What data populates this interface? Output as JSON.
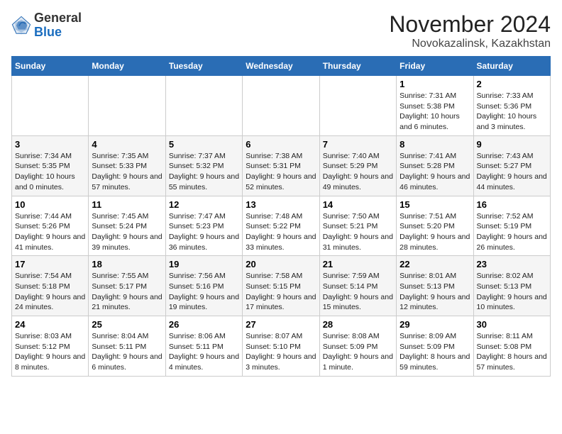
{
  "logo": {
    "general": "General",
    "blue": "Blue"
  },
  "header": {
    "month": "November 2024",
    "location": "Novokazalinsk, Kazakhstan"
  },
  "weekdays": [
    "Sunday",
    "Monday",
    "Tuesday",
    "Wednesday",
    "Thursday",
    "Friday",
    "Saturday"
  ],
  "weeks": [
    [
      {
        "day": "",
        "info": ""
      },
      {
        "day": "",
        "info": ""
      },
      {
        "day": "",
        "info": ""
      },
      {
        "day": "",
        "info": ""
      },
      {
        "day": "",
        "info": ""
      },
      {
        "day": "1",
        "info": "Sunrise: 7:31 AM\nSunset: 5:38 PM\nDaylight: 10 hours and 6 minutes."
      },
      {
        "day": "2",
        "info": "Sunrise: 7:33 AM\nSunset: 5:36 PM\nDaylight: 10 hours and 3 minutes."
      }
    ],
    [
      {
        "day": "3",
        "info": "Sunrise: 7:34 AM\nSunset: 5:35 PM\nDaylight: 10 hours and 0 minutes."
      },
      {
        "day": "4",
        "info": "Sunrise: 7:35 AM\nSunset: 5:33 PM\nDaylight: 9 hours and 57 minutes."
      },
      {
        "day": "5",
        "info": "Sunrise: 7:37 AM\nSunset: 5:32 PM\nDaylight: 9 hours and 55 minutes."
      },
      {
        "day": "6",
        "info": "Sunrise: 7:38 AM\nSunset: 5:31 PM\nDaylight: 9 hours and 52 minutes."
      },
      {
        "day": "7",
        "info": "Sunrise: 7:40 AM\nSunset: 5:29 PM\nDaylight: 9 hours and 49 minutes."
      },
      {
        "day": "8",
        "info": "Sunrise: 7:41 AM\nSunset: 5:28 PM\nDaylight: 9 hours and 46 minutes."
      },
      {
        "day": "9",
        "info": "Sunrise: 7:43 AM\nSunset: 5:27 PM\nDaylight: 9 hours and 44 minutes."
      }
    ],
    [
      {
        "day": "10",
        "info": "Sunrise: 7:44 AM\nSunset: 5:26 PM\nDaylight: 9 hours and 41 minutes."
      },
      {
        "day": "11",
        "info": "Sunrise: 7:45 AM\nSunset: 5:24 PM\nDaylight: 9 hours and 39 minutes."
      },
      {
        "day": "12",
        "info": "Sunrise: 7:47 AM\nSunset: 5:23 PM\nDaylight: 9 hours and 36 minutes."
      },
      {
        "day": "13",
        "info": "Sunrise: 7:48 AM\nSunset: 5:22 PM\nDaylight: 9 hours and 33 minutes."
      },
      {
        "day": "14",
        "info": "Sunrise: 7:50 AM\nSunset: 5:21 PM\nDaylight: 9 hours and 31 minutes."
      },
      {
        "day": "15",
        "info": "Sunrise: 7:51 AM\nSunset: 5:20 PM\nDaylight: 9 hours and 28 minutes."
      },
      {
        "day": "16",
        "info": "Sunrise: 7:52 AM\nSunset: 5:19 PM\nDaylight: 9 hours and 26 minutes."
      }
    ],
    [
      {
        "day": "17",
        "info": "Sunrise: 7:54 AM\nSunset: 5:18 PM\nDaylight: 9 hours and 24 minutes."
      },
      {
        "day": "18",
        "info": "Sunrise: 7:55 AM\nSunset: 5:17 PM\nDaylight: 9 hours and 21 minutes."
      },
      {
        "day": "19",
        "info": "Sunrise: 7:56 AM\nSunset: 5:16 PM\nDaylight: 9 hours and 19 minutes."
      },
      {
        "day": "20",
        "info": "Sunrise: 7:58 AM\nSunset: 5:15 PM\nDaylight: 9 hours and 17 minutes."
      },
      {
        "day": "21",
        "info": "Sunrise: 7:59 AM\nSunset: 5:14 PM\nDaylight: 9 hours and 15 minutes."
      },
      {
        "day": "22",
        "info": "Sunrise: 8:01 AM\nSunset: 5:13 PM\nDaylight: 9 hours and 12 minutes."
      },
      {
        "day": "23",
        "info": "Sunrise: 8:02 AM\nSunset: 5:13 PM\nDaylight: 9 hours and 10 minutes."
      }
    ],
    [
      {
        "day": "24",
        "info": "Sunrise: 8:03 AM\nSunset: 5:12 PM\nDaylight: 9 hours and 8 minutes."
      },
      {
        "day": "25",
        "info": "Sunrise: 8:04 AM\nSunset: 5:11 PM\nDaylight: 9 hours and 6 minutes."
      },
      {
        "day": "26",
        "info": "Sunrise: 8:06 AM\nSunset: 5:11 PM\nDaylight: 9 hours and 4 minutes."
      },
      {
        "day": "27",
        "info": "Sunrise: 8:07 AM\nSunset: 5:10 PM\nDaylight: 9 hours and 3 minutes."
      },
      {
        "day": "28",
        "info": "Sunrise: 8:08 AM\nSunset: 5:09 PM\nDaylight: 9 hours and 1 minute."
      },
      {
        "day": "29",
        "info": "Sunrise: 8:09 AM\nSunset: 5:09 PM\nDaylight: 8 hours and 59 minutes."
      },
      {
        "day": "30",
        "info": "Sunrise: 8:11 AM\nSunset: 5:08 PM\nDaylight: 8 hours and 57 minutes."
      }
    ]
  ]
}
